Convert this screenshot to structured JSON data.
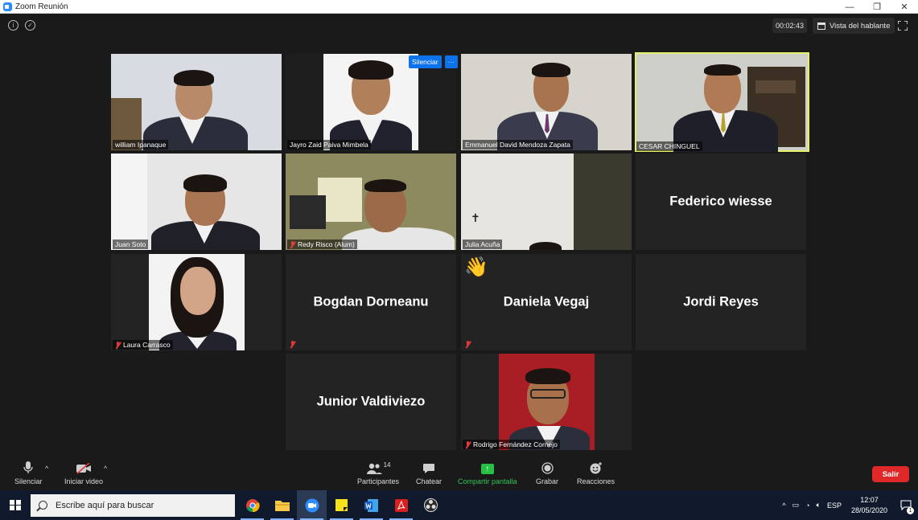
{
  "window": {
    "title": "Zoom Reunión",
    "controls": [
      "—",
      "❐",
      "✕"
    ]
  },
  "meeting": {
    "timer": "00:02:43",
    "view_toggle": "Vista del hablante",
    "hover_buttons": {
      "mute": "Silenciar",
      "more": "···"
    }
  },
  "participants": [
    {
      "name": "william Ipanaque",
      "video": true,
      "muted": false
    },
    {
      "name": "Jayro Zaid Paiva Mimbela",
      "video": true,
      "muted": false
    },
    {
      "name": "Emmanuel David Mendoza Zapata",
      "video": true,
      "muted": false
    },
    {
      "name": "CESAR CHINGUEL",
      "video": true,
      "muted": false,
      "active_speaker": true
    },
    {
      "name": "Juan Soto",
      "video": true,
      "muted": false
    },
    {
      "name": "Redy Risco (Alum)",
      "video": true,
      "muted": true
    },
    {
      "name": "Julia Acuña",
      "video": true,
      "muted": false
    },
    {
      "name": "Federico wiesse",
      "video": false,
      "muted": false
    },
    {
      "name": "Laura Carrasco",
      "video": true,
      "muted": true
    },
    {
      "name": "Bogdan Dorneanu",
      "video": false,
      "muted": true
    },
    {
      "name": "Daniela Vegaj",
      "video": false,
      "muted": true,
      "reaction": "👋"
    },
    {
      "name": "Jordi Reyes",
      "video": false,
      "muted": false
    },
    {
      "name": "Junior Valdiviezo",
      "video": false,
      "muted": false
    },
    {
      "name": "Rodrigo Fernández Cornejo",
      "video": true,
      "muted": true
    }
  ],
  "toolbar": {
    "mute": "Silenciar",
    "video": "Iniciar video",
    "participants": "Participantes",
    "participants_count": "14",
    "chat": "Chatear",
    "share": "Compartir pantalla",
    "record": "Grabar",
    "reactions": "Reacciones",
    "leave": "Salir"
  },
  "taskbar": {
    "search_placeholder": "Escribe aquí para buscar",
    "language": "ESP",
    "time": "12:07",
    "date": "28/05/2020",
    "notification_count": "1"
  },
  "colors": {
    "zoom_blue": "#2d8cff",
    "active_border": "#e4f06a",
    "share_green": "#26c046",
    "leave_red": "#e02828",
    "mute_red": "#e03a3a"
  }
}
